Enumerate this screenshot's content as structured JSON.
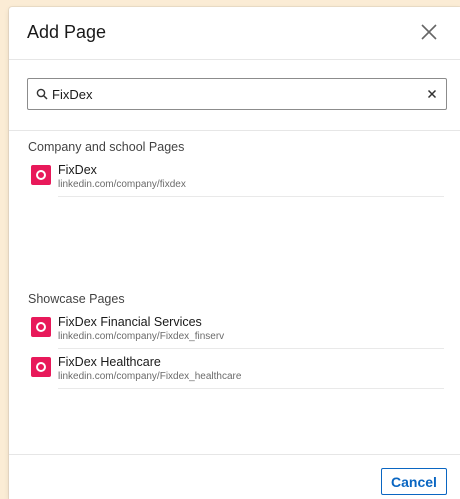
{
  "modal": {
    "title": "Add Page",
    "close_icon": "close-icon"
  },
  "search": {
    "icon": "search-icon",
    "value": "FixDex",
    "clear_icon": "clear-icon"
  },
  "company_section": {
    "heading": "Company and school Pages",
    "items": [
      {
        "name": "FixDex",
        "url": "linkedin.com/company/fixdex"
      }
    ]
  },
  "showcase_section": {
    "heading": "Showcase Pages",
    "items": [
      {
        "name": "FixDex Financial Services",
        "url": "linkedin.com/company/Fixdex_finserv"
      },
      {
        "name": "FixDex Healthcare",
        "url": "linkedin.com/company/Fixdex_healthcare"
      }
    ]
  },
  "footer": {
    "cancel_label": "Cancel"
  },
  "colors": {
    "backdrop": "#fbecd5",
    "logo": "#e8195a",
    "primary": "#0a66c2"
  }
}
